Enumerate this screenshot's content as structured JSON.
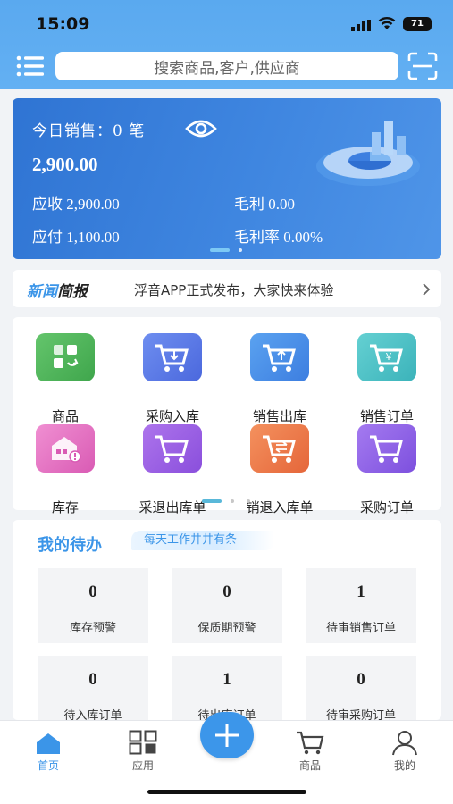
{
  "status_bar": {
    "time": "15:09",
    "battery": "71"
  },
  "search": {
    "placeholder": "搜索商品,客户,供应商"
  },
  "banner": {
    "title": "今日销售：0 笔",
    "total": "2,900.00",
    "receivable": "应收 2,900.00",
    "gross_profit": "毛利 0.00",
    "payable": "应付 1,100.00",
    "gross_margin": "毛利率 0.00%"
  },
  "news": {
    "tag_a": "新闻",
    "tag_b": "简报",
    "text": "浮音APP正式发布，大家快来体验"
  },
  "grid": {
    "items": [
      {
        "label": "商品",
        "color": "#52b85a",
        "icon": "goods-icon"
      },
      {
        "label": "采购入库",
        "color": "#5b7be8",
        "icon": "cart-in-icon"
      },
      {
        "label": "销售出库",
        "color": "#4b8fe8",
        "icon": "cart-out-icon"
      },
      {
        "label": "销售订单",
        "color": "#4fc3c8",
        "icon": "cart-yen-icon"
      },
      {
        "label": "库存",
        "color": "#e36fc0",
        "icon": "warehouse-icon"
      },
      {
        "label": "采退出库单",
        "color": "#9b5fe0",
        "icon": "cart-return-icon"
      },
      {
        "label": "销退入库单",
        "color": "#ee7a47",
        "icon": "cart-exchange-icon"
      },
      {
        "label": "采购订单",
        "color": "#9261e6",
        "icon": "cart-order-icon"
      }
    ]
  },
  "todo": {
    "title": "我的待办",
    "tag": "每天工作井井有条",
    "cards": [
      {
        "value": "0",
        "label": "库存预警"
      },
      {
        "value": "0",
        "label": "保质期预警"
      },
      {
        "value": "1",
        "label": "待审销售订单"
      },
      {
        "value": "0",
        "label": "待入库订单"
      },
      {
        "value": "1",
        "label": "待出库订单"
      },
      {
        "value": "0",
        "label": "待审采购订单"
      }
    ]
  },
  "tabs": [
    {
      "label": "首页",
      "icon": "home-icon",
      "active": true
    },
    {
      "label": "应用",
      "icon": "apps-icon",
      "active": false
    },
    {
      "label": "商品",
      "icon": "cart-icon",
      "active": false
    },
    {
      "label": "我的",
      "icon": "profile-icon",
      "active": false
    }
  ],
  "colors": {
    "accent": "#3b95e8",
    "header": "#5aa9ef",
    "banner": "#2f74d3"
  }
}
